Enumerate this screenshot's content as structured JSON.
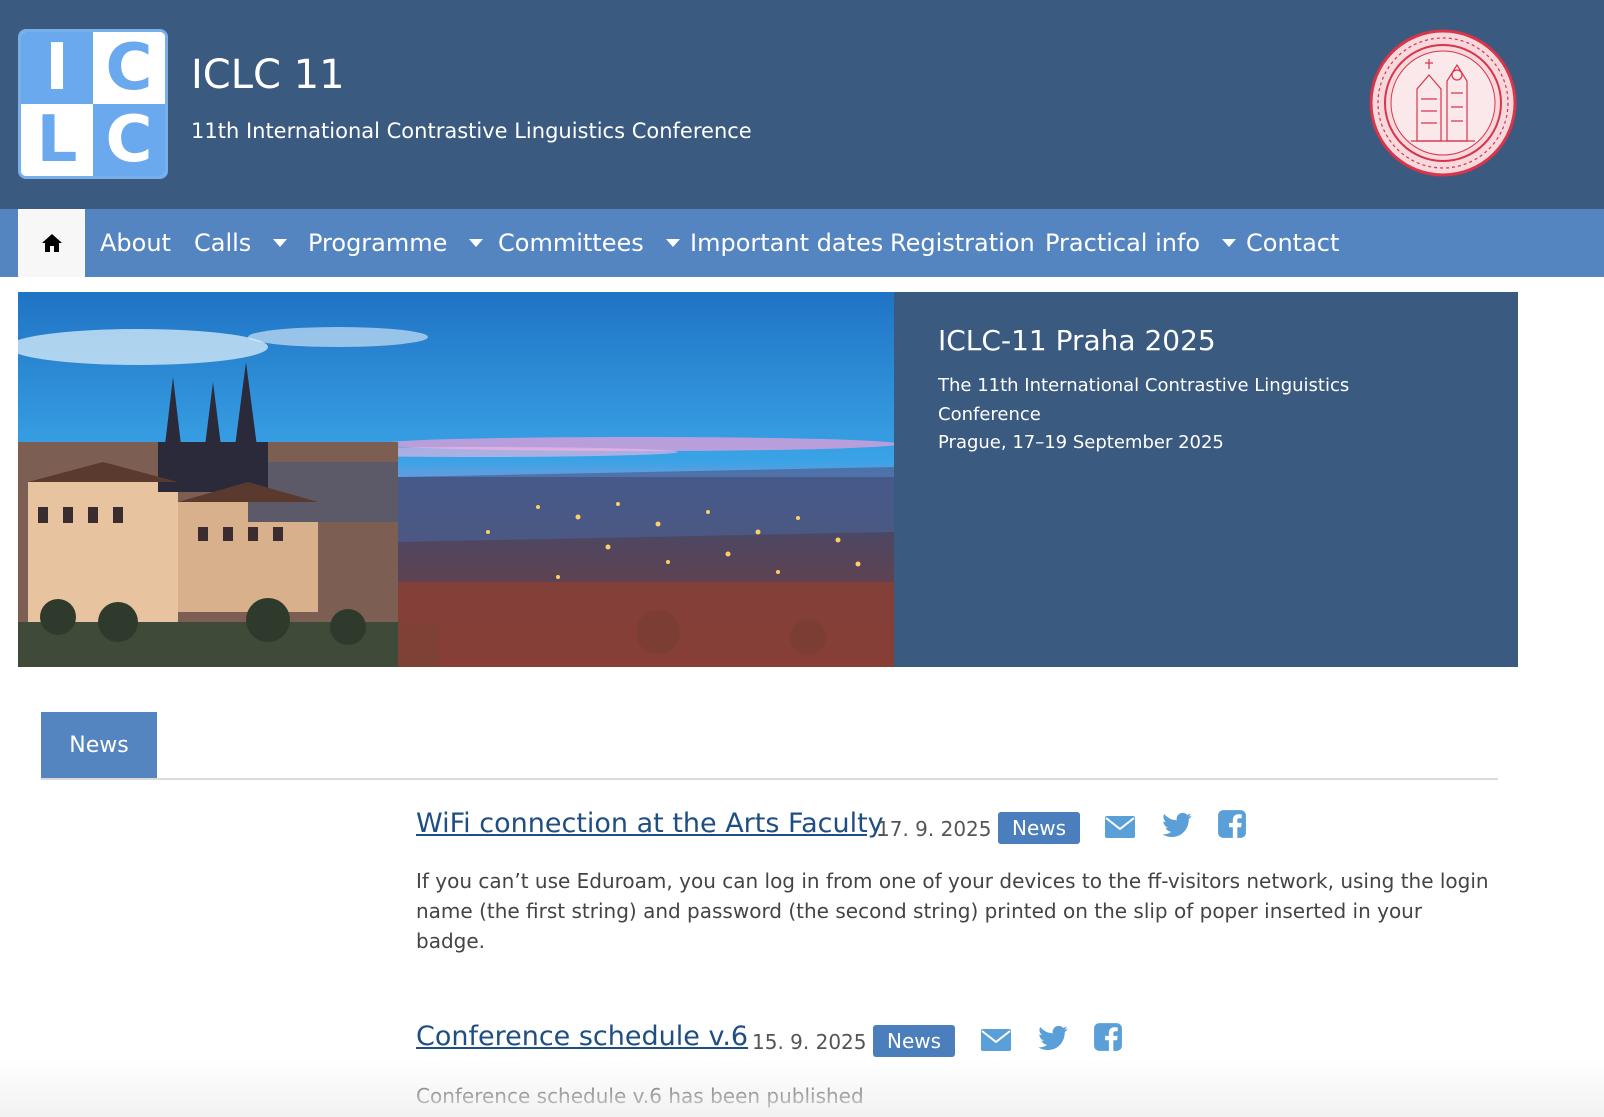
{
  "header": {
    "logo": {
      "letters": [
        "I",
        "C",
        "L",
        "C"
      ]
    },
    "title": "ICLC 11",
    "subtitle": "11th International Contrastive Linguistics Conference"
  },
  "nav": {
    "home_icon": "home-icon",
    "items": [
      {
        "label": "About",
        "has_dropdown": false
      },
      {
        "label": "Calls",
        "has_dropdown": true
      },
      {
        "label": "Programme",
        "has_dropdown": true
      },
      {
        "label": "Committees",
        "has_dropdown": true
      },
      {
        "label": "Important dates",
        "has_dropdown": false
      },
      {
        "label": "Registration",
        "has_dropdown": false
      },
      {
        "label": "Practical info",
        "has_dropdown": true
      },
      {
        "label": "Contact",
        "has_dropdown": false
      }
    ]
  },
  "hero": {
    "title": "ICLC-11 Praha 2025",
    "line1": "The 11th International Contrastive Linguistics",
    "line2": "Conference",
    "line3": "Prague, 17–19 September 2025"
  },
  "news_tab": {
    "label": "News"
  },
  "articles": [
    {
      "title": "WiFi connection at the Arts Faculty",
      "date": "17. 9. 2025",
      "category": "News",
      "body": "If you can’t use Eduroam, you can log in from one of your devices to the ff-visitors network, using the login name (the first string) and password (the second string) printed on the slip of poper inserted in your badge.",
      "share_icons": [
        "email-icon",
        "twitter-icon",
        "facebook-icon"
      ]
    },
    {
      "title": "Conference schedule v.6",
      "date": "15. 9. 2025",
      "category": "News",
      "body": "Conference schedule v.6 has been published",
      "share_icons": [
        "email-icon",
        "twitter-icon",
        "facebook-icon"
      ]
    }
  ],
  "colors": {
    "header_bg": "#3a5a80",
    "nav_bg": "#5585c0",
    "accent": "#4a7ebc",
    "link": "#1f4f82",
    "share_icon": "#5a9fd8",
    "seal": "#d8344a"
  }
}
